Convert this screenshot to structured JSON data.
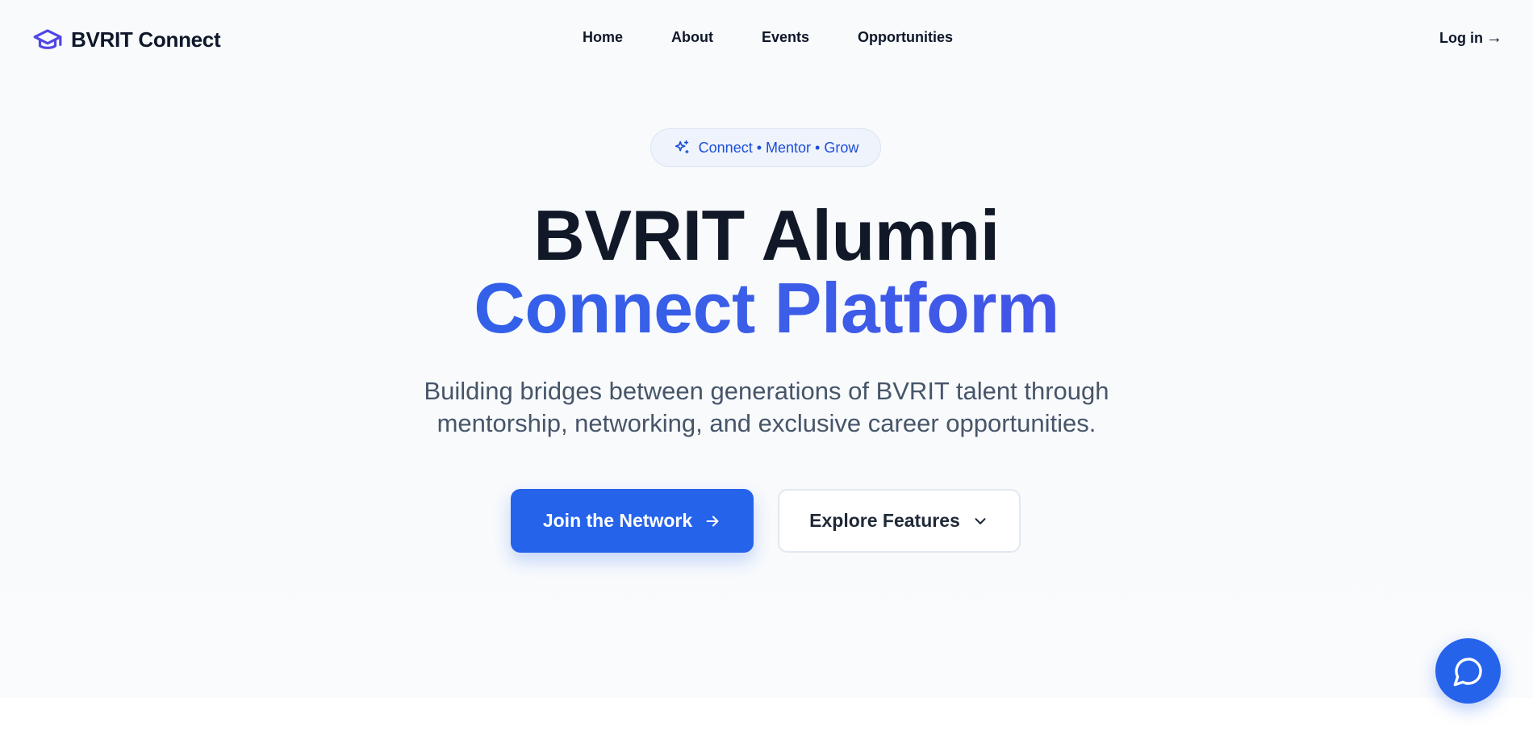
{
  "brand": {
    "name": "BVRIT Connect",
    "icon": "graduation-cap-icon",
    "accent_color": "#4f46e5"
  },
  "nav": {
    "items": [
      {
        "label": "Home"
      },
      {
        "label": "About"
      },
      {
        "label": "Events"
      },
      {
        "label": "Opportunities"
      }
    ],
    "login_label": "Log in",
    "login_arrow": "→"
  },
  "hero": {
    "tagline": "Connect • Mentor • Grow",
    "tagline_icon": "sparkles-icon",
    "title_line1": "BVRIT Alumni",
    "title_line2": "Connect Platform",
    "subtitle": "Building bridges between generations of BVRIT talent through mentorship, networking, and exclusive career opportunities.",
    "primary_button": "Join the Network",
    "secondary_button": "Explore Features",
    "primary_color": "#2563eb"
  },
  "chat": {
    "icon": "chat-bubble-icon"
  }
}
